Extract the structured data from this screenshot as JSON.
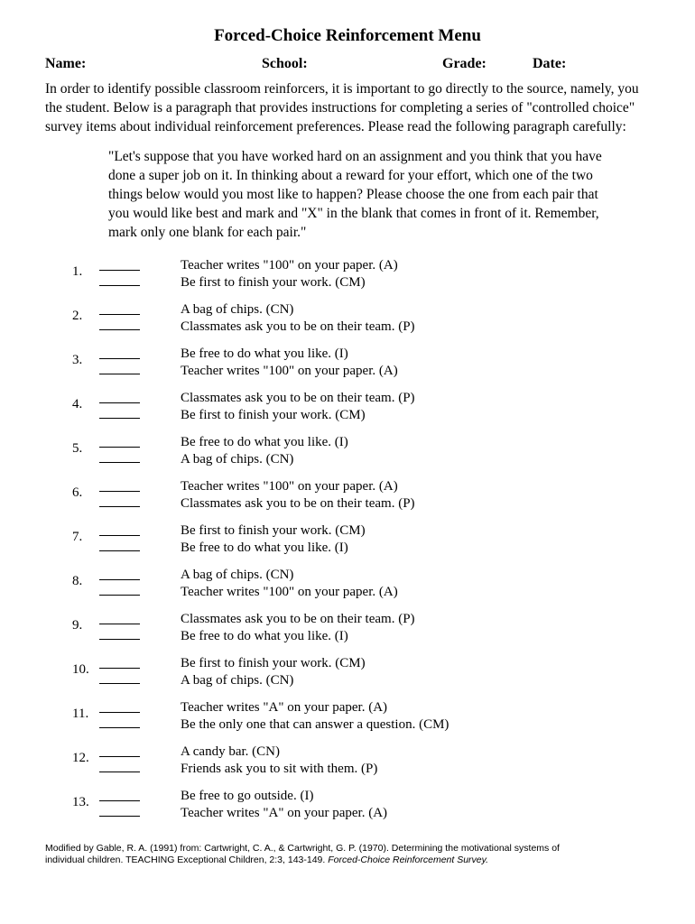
{
  "title": "Forced-Choice Reinforcement Menu",
  "header": {
    "name": "Name:",
    "school": "School:",
    "grade": "Grade:",
    "date": "Date:"
  },
  "intro": "In order to identify possible classroom reinforcers, it is important to go directly to the source, namely, you the student. Below is a paragraph that provides instructions for completing a series of \"controlled choice\" survey items about individual reinforcement preferences. Please read the following paragraph carefully:",
  "instructions": "\"Let's suppose that you have worked hard on an assignment and you think that you have done a super job on it. In thinking about a reward for your effort, which one of the two things below would you most like to happen? Please choose the one from each pair that you would like best and mark and \"X\" in the blank that comes in front of it. Remember, mark only one blank for each pair.\"",
  "items": [
    {
      "num": "1.",
      "a": "Teacher writes \"100\" on your paper. (A)",
      "b": "Be first to finish your work. (CM)"
    },
    {
      "num": "2.",
      "a": "A bag of chips. (CN)",
      "b": "Classmates ask you to be on their team. (P)"
    },
    {
      "num": "3.",
      "a": "Be free to do what you like. (I)",
      "b": "Teacher writes \"100\" on your paper. (A)"
    },
    {
      "num": "4.",
      "a": "Classmates ask you to be on their team. (P)",
      "b": "Be first to finish your work. (CM)"
    },
    {
      "num": "5.",
      "a": "Be free to do what you like. (I)",
      "b": "A bag of chips. (CN)"
    },
    {
      "num": "6.",
      "a": "Teacher writes \"100\" on your paper. (A)",
      "b": "Classmates ask you to be on their team. (P)"
    },
    {
      "num": "7.",
      "a": "Be first to finish your work. (CM)",
      "b": "Be free to do what you like. (I)"
    },
    {
      "num": "8.",
      "a": "A bag of chips. (CN)",
      "b": "Teacher writes \"100\" on your paper. (A)"
    },
    {
      "num": "9.",
      "a": "Classmates ask you to be on their team. (P)",
      "b": "Be free to do what you like. (I)"
    },
    {
      "num": "10.",
      "a": "Be first to finish your work. (CM)",
      "b": "A bag of chips. (CN)"
    },
    {
      "num": "11.",
      "a": "Teacher writes \"A\" on your paper. (A)",
      "b": "Be the only one that can answer a question. (CM)"
    },
    {
      "num": "12.",
      "a": "A candy bar. (CN)",
      "b": "Friends ask you to sit with them. (P)"
    },
    {
      "num": "13.",
      "a": "Be free to go outside. (I)",
      "b": "Teacher writes \"A\" on your paper. (A)"
    }
  ],
  "footer": {
    "line1": "Modified by Gable, R. A. (1991) from: Cartwright, C. A., & Cartwright, G. P. (1970). Determining the motivational systems of",
    "line2a": "individual children. TEACHING Exceptional Children, 2:3, 143-149. ",
    "line2b": "Forced-Choice Reinforcement Survey."
  }
}
